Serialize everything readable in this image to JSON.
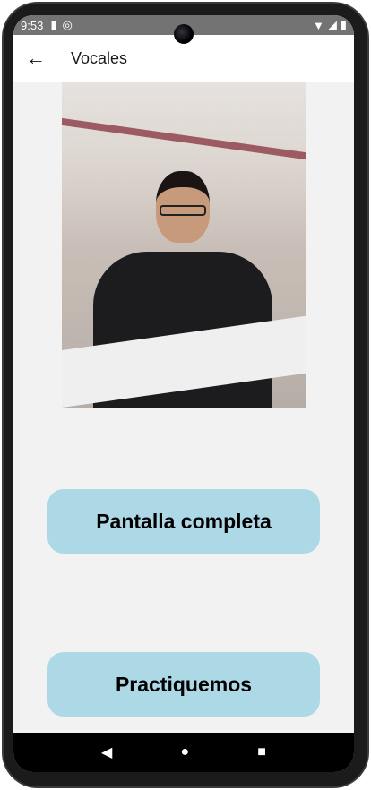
{
  "status_bar": {
    "time": "9:53",
    "icons": [
      "sd-card-icon",
      "data-saver-icon",
      "wifi-icon",
      "signal-icon",
      "battery-icon"
    ]
  },
  "app_bar": {
    "title": "Vocales",
    "back_icon": "arrow-left-icon"
  },
  "video": {
    "content": "sign-language-demo-video"
  },
  "buttons": {
    "fullscreen": "Pantalla completa",
    "practice": "Practiquemos"
  },
  "colors": {
    "button": "#add8e6",
    "background": "#f2f2f2",
    "status_bar": "#737373"
  },
  "nav_bar": {
    "icons": [
      "back-triangle-icon",
      "home-circle-icon",
      "recents-square-icon"
    ]
  }
}
